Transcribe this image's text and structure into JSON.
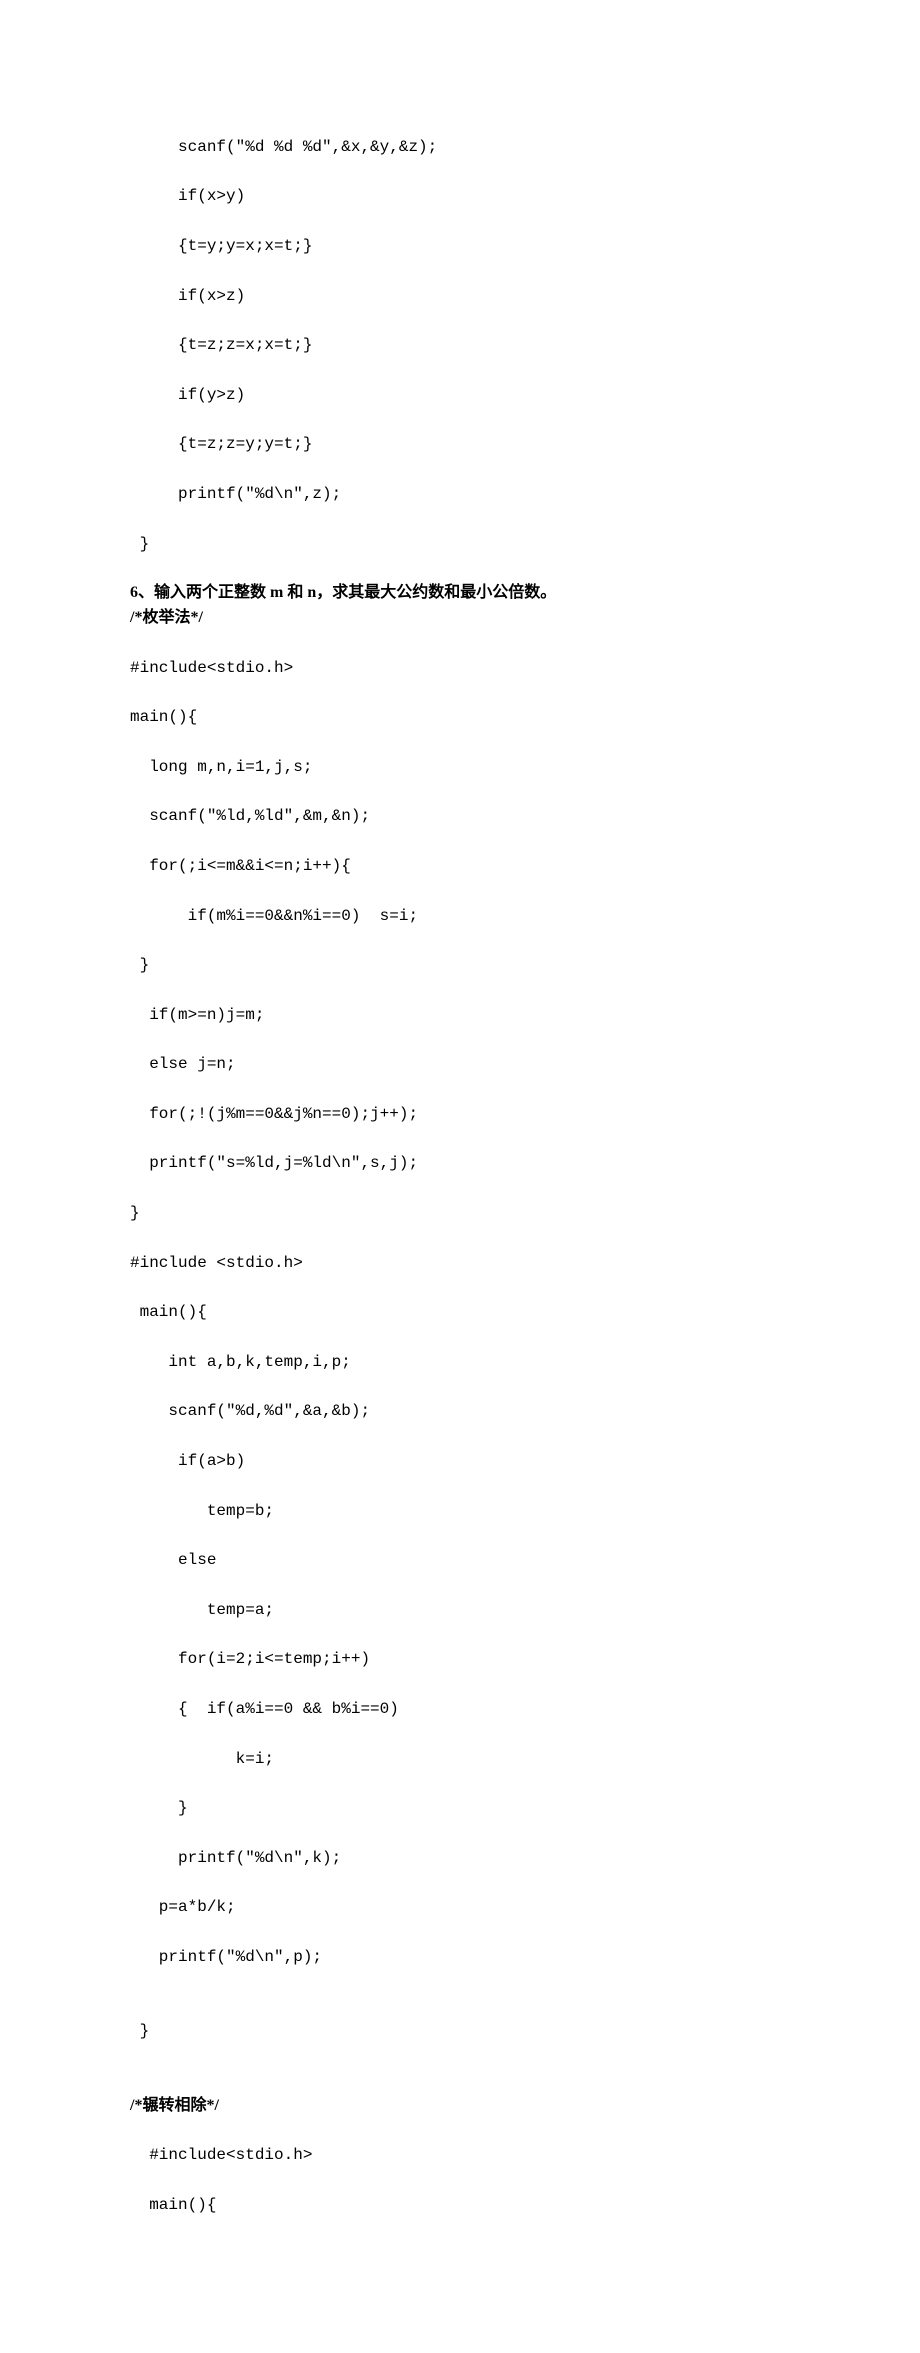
{
  "block1": {
    "l1": "     scanf(\"%d %d %d\",&x,&y,&z);",
    "l2": "     if(x>y)",
    "l3": "     {t=y;y=x;x=t;}",
    "l4": "     if(x>z)",
    "l5": "     {t=z;z=x;x=t;}",
    "l6": "     if(y>z)",
    "l7": "     {t=z;z=y;y=t;}",
    "l8": "     printf(\"%d\\n\",z);",
    "l9": " }"
  },
  "heading6": "6、输入两个正整数 m 和 n，求其最大公约数和最小公倍数。",
  "comment1": "/*枚举法*/",
  "block2": {
    "l1": "#include<stdio.h>",
    "l2": "main(){",
    "l3": "  long m,n,i=1,j,s;",
    "l4": "  scanf(\"%ld,%ld\",&m,&n);",
    "l5": "  for(;i<=m&&i<=n;i++){",
    "l6": "      if(m%i==0&&n%i==0)  s=i;",
    "l7": " }",
    "l8": "  if(m>=n)j=m;",
    "l9": "  else j=n;",
    "l10": "  for(;!(j%m==0&&j%n==0);j++);",
    "l11": "  printf(\"s=%ld,j=%ld\\n\",s,j);",
    "l12": "}",
    "l13": "#include <stdio.h>",
    "l14": " main(){",
    "l15": "    int a,b,k,temp,i,p;",
    "l16": "    scanf(\"%d,%d\",&a,&b);",
    "l17": "     if(a>b)",
    "l18": "        temp=b;",
    "l19": "     else",
    "l20": "        temp=a;",
    "l21": "     for(i=2;i<=temp;i++)",
    "l22": "     {  if(a%i==0 && b%i==0)",
    "l23": "           k=i;",
    "l24": "     }",
    "l25": "     printf(\"%d\\n\",k);",
    "l26": "   p=a*b/k;",
    "l27": "   printf(\"%d\\n\",p);",
    "l28": "",
    "l29": " }"
  },
  "comment2": "/*辗转相除*/",
  "block3": {
    "l1": "  #include<stdio.h>",
    "l2": "  main(){"
  }
}
